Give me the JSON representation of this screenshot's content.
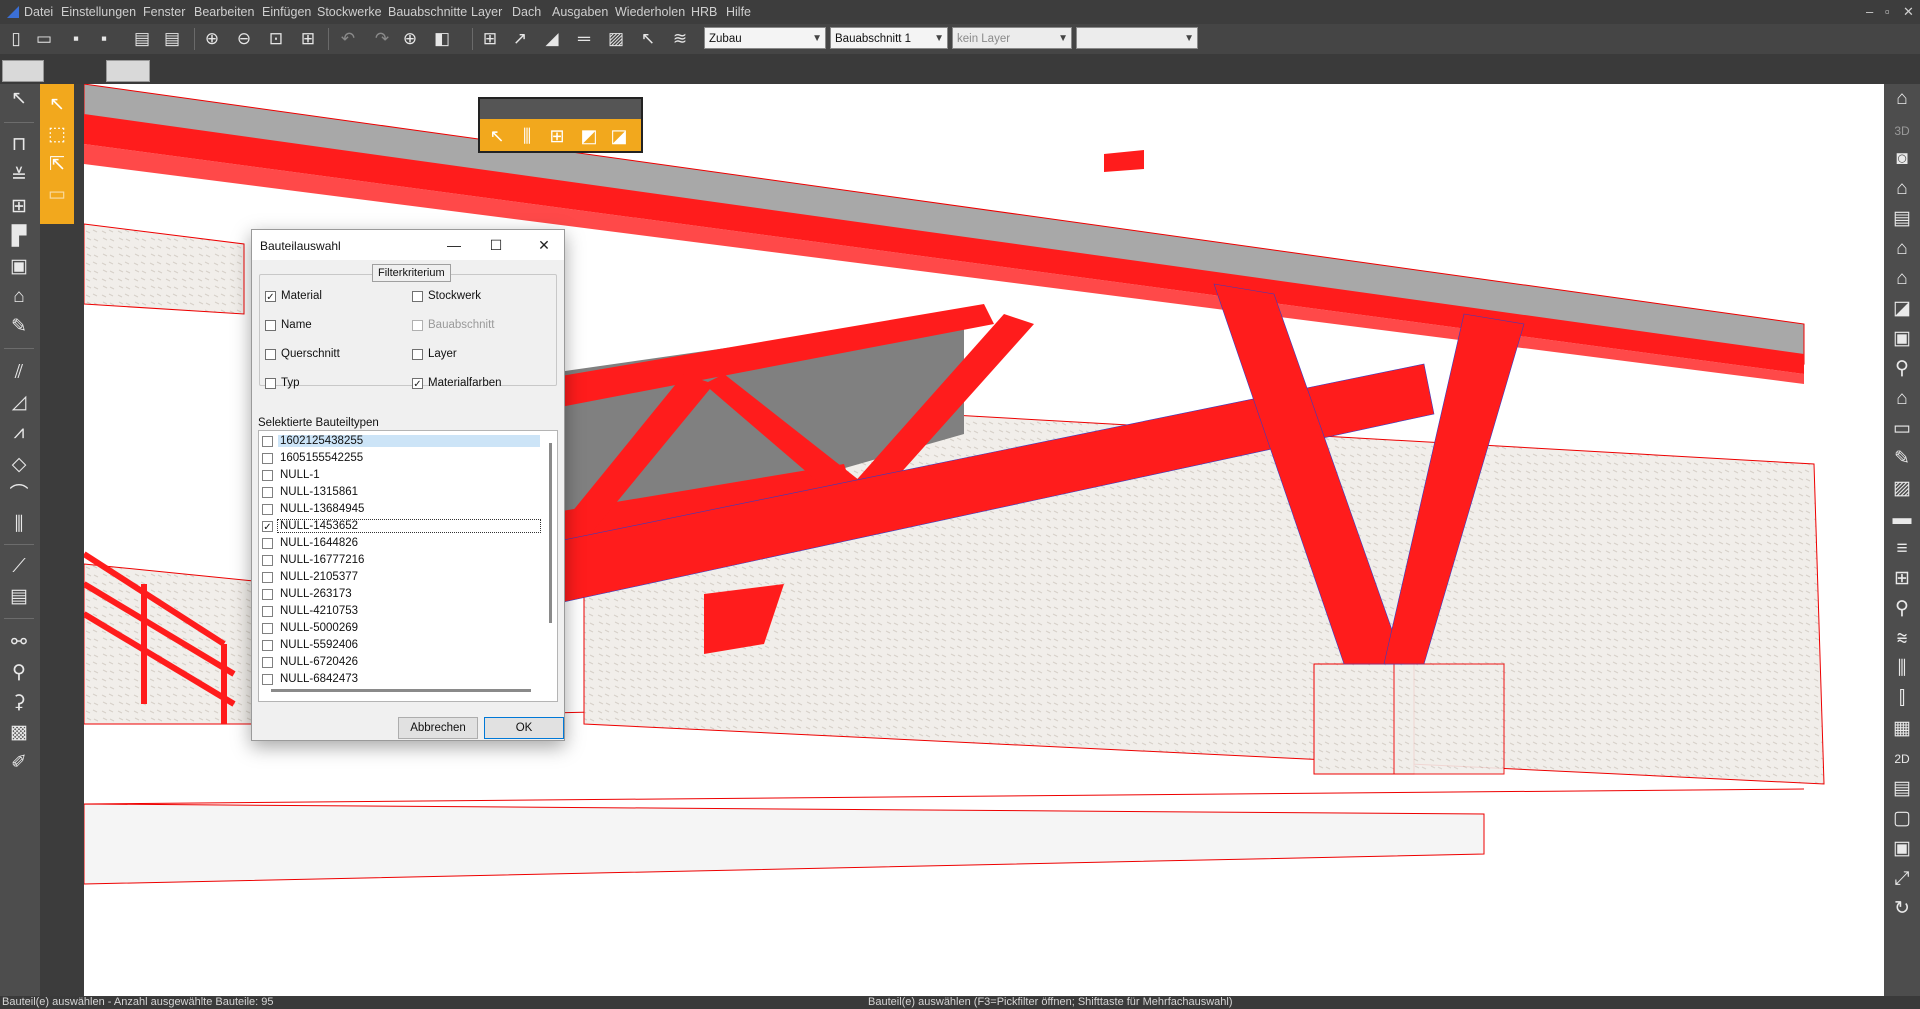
{
  "menu": {
    "items": [
      "Datei",
      "Einstellungen",
      "Fenster",
      "Bearbeiten",
      "Einfügen",
      "Stockwerke",
      "Bauabschnitte",
      "Layer",
      "Dach",
      "Ausgaben",
      "Wiederholen",
      "HRB",
      "Hilfe"
    ]
  },
  "toolbar": {
    "combos": [
      {
        "value": "Zubau",
        "enabled": true
      },
      {
        "value": "Bauabschnitt 1",
        "enabled": true
      },
      {
        "value": "kein Layer",
        "enabled": false
      },
      {
        "value": "",
        "enabled": false
      }
    ]
  },
  "right_toolbar": {
    "view_3d_label": "3D",
    "view_2d_label": "2D"
  },
  "dialog": {
    "title": "Bauteilauswahl",
    "filter_group_label": "Filterkriterium",
    "filters": [
      {
        "label": "Material",
        "checked": true,
        "enabled": true
      },
      {
        "label": "Stockwerk",
        "checked": false,
        "enabled": true
      },
      {
        "label": "Name",
        "checked": false,
        "enabled": true
      },
      {
        "label": "Bauabschnitt",
        "checked": false,
        "enabled": false
      },
      {
        "label": "Querschnitt",
        "checked": false,
        "enabled": true
      },
      {
        "label": "Layer",
        "checked": false,
        "enabled": true
      },
      {
        "label": "Typ",
        "checked": false,
        "enabled": true
      },
      {
        "label": "Materialfarben",
        "checked": true,
        "enabled": true
      }
    ],
    "list_label": "Selektierte Bauteiltypen",
    "list_items": [
      {
        "label": "1602125438255",
        "checked": false,
        "selected": true
      },
      {
        "label": "1605155542255",
        "checked": false
      },
      {
        "label": "NULL-1",
        "checked": false
      },
      {
        "label": "NULL-1315861",
        "checked": false
      },
      {
        "label": "NULL-13684945",
        "checked": false
      },
      {
        "label": "NULL-1453652",
        "checked": true,
        "focused": true
      },
      {
        "label": "NULL-1644826",
        "checked": false
      },
      {
        "label": "NULL-16777216",
        "checked": false
      },
      {
        "label": "NULL-2105377",
        "checked": false
      },
      {
        "label": "NULL-263173",
        "checked": false
      },
      {
        "label": "NULL-4210753",
        "checked": false
      },
      {
        "label": "NULL-5000269",
        "checked": false
      },
      {
        "label": "NULL-5592406",
        "checked": false
      },
      {
        "label": "NULL-6720426",
        "checked": false
      },
      {
        "label": "NULL-6842473",
        "checked": false
      }
    ],
    "cancel_label": "Abbrechen",
    "ok_label": "OK"
  },
  "status": {
    "left": "Bauteil(e) auswählen  -  Anzahl ausgewählte Bauteile: 95",
    "center": "Bauteil(e) auswählen (F3=Pickfilter öffnen; Shifttaste für Mehrfachauswahl)"
  },
  "colors": {
    "steel_red": "#ff1c1c",
    "highlight_orange": "#f2a81d",
    "chrome": "#454545"
  }
}
